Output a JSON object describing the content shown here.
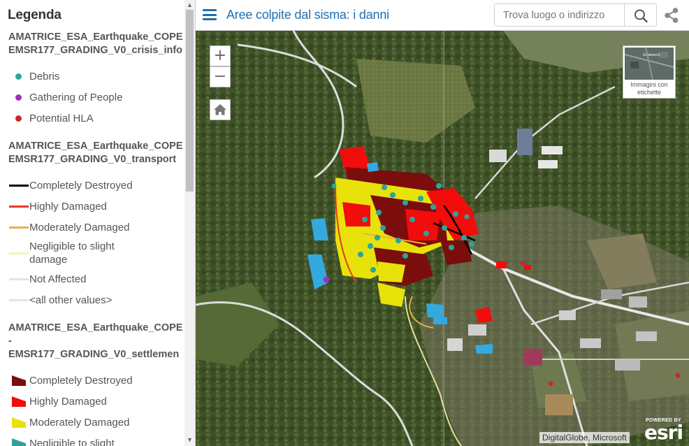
{
  "legend": {
    "title": "Legenda",
    "layers": [
      {
        "title_lines": [
          "AMATRICE_ESA_Earthquake_COPE",
          "EMSR177_GRADING_V0_crisis_info"
        ],
        "items": [
          {
            "label": "Debris",
            "symbol": "point",
            "color": "#2aa59b"
          },
          {
            "label": "Gathering of People",
            "symbol": "point",
            "color": "#a12fbd"
          },
          {
            "label": "Potential HLA",
            "symbol": "point",
            "color": "#c52a2a"
          }
        ]
      },
      {
        "title_lines": [
          "AMATRICE_ESA_Earthquake_COPE",
          "EMSR177_GRADING_V0_transport"
        ],
        "items": [
          {
            "label": "Completely Destroyed",
            "symbol": "line",
            "color": "#000000"
          },
          {
            "label": "Highly Damaged",
            "symbol": "line",
            "color": "#e8391f"
          },
          {
            "label": "Moderately Damaged",
            "symbol": "line",
            "color": "#e7b04a"
          },
          {
            "label": "Negligible to slight damage",
            "label_lines": [
              "Negligible to slight",
              "damage"
            ],
            "symbol": "line",
            "color": "#f6f3b2"
          },
          {
            "label": "Not Affected",
            "symbol": "line",
            "color": "#e4e4e4"
          },
          {
            "label": "<all other values>",
            "symbol": "line",
            "color": "#e4e4e4"
          }
        ]
      },
      {
        "title_lines": [
          "AMATRICE_ESA_Earthquake_COPE",
          "-",
          "EMSR177_GRADING_V0_settlemen"
        ],
        "items": [
          {
            "label": "Completely Destroyed",
            "symbol": "polygon",
            "color": "#7b0d0d"
          },
          {
            "label": "Highly Damaged",
            "symbol": "polygon",
            "color": "#f20c0c"
          },
          {
            "label": "Moderately Damaged",
            "symbol": "polygon",
            "color": "#e8e20b"
          },
          {
            "label": "Negligible to slight",
            "symbol": "polygon",
            "color": "#2aa59b"
          }
        ]
      }
    ]
  },
  "header": {
    "title": "Aree colpite dal sisma: i danni",
    "search_placeholder": "Trova luogo o indirizzo",
    "accent_color": "#1f6fb2"
  },
  "map": {
    "zoom_in_label": "+",
    "zoom_out_label": "−",
    "home_icon": "home-icon",
    "basemap_label": "Immagini con etichette",
    "basemap_thumb_text": "St James's",
    "attribution": "DigitalGlobe, Microsoft",
    "esri_powered": "POWERED BY",
    "esri_word": "esri"
  }
}
